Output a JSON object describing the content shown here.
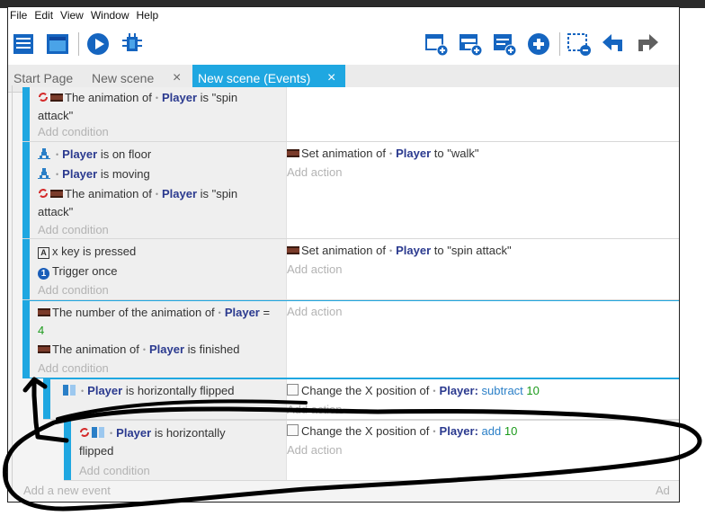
{
  "menu": [
    "File",
    "Edit",
    "View",
    "Window",
    "Help"
  ],
  "toolbar_left_icons": [
    "project-manager-icon",
    "scene-editor-icon",
    "preview-play-icon",
    "debugger-icon"
  ],
  "toolbar_right_icons": [
    "add-event-icon",
    "add-subevent-icon",
    "add-comment-icon",
    "add-more-icon",
    "delete-icon",
    "undo-icon",
    "redo-icon"
  ],
  "tabs": [
    {
      "label": "Start Page",
      "active": false
    },
    {
      "label": "New scene",
      "active": false
    },
    {
      "label": "New scene (Events)",
      "active": true
    }
  ],
  "tab_close_glyph": "×",
  "common": {
    "add_condition": "Add condition",
    "add_action": "Add action",
    "add_new_event": "Add a new event",
    "add_new_event_right": "Ad"
  },
  "events": {
    "e1": {
      "cond1": {
        "pre": "The animation of",
        "obj": "Player",
        "post": "is \"spin attack\""
      }
    },
    "e2": {
      "cond1": {
        "obj": "Player",
        "post": "is on floor"
      },
      "cond2": {
        "obj": "Player",
        "post": "is moving"
      },
      "cond3": {
        "pre": "The animation of",
        "obj": "Player",
        "post": "is \"spin attack\""
      },
      "act1": {
        "pre": "Set animation of",
        "obj": "Player",
        "post": "to \"walk\""
      }
    },
    "e3": {
      "cond1": {
        "key": "x",
        "text": "x key is pressed",
        "glyph": "A"
      },
      "cond2": {
        "text": "Trigger once",
        "glyph": "1"
      },
      "act1": {
        "pre": "Set animation of",
        "obj": "Player",
        "post": "to \"spin attack\""
      }
    },
    "e4": {
      "cond1": {
        "pre": "The number of the animation of",
        "obj": "Player",
        "op": "=",
        "val": "4"
      },
      "cond2": {
        "pre": "The animation of",
        "obj": "Player",
        "post": "is finished"
      }
    },
    "e5": {
      "cond1": {
        "obj": "Player",
        "post": "is horizontally flipped"
      },
      "act1": {
        "pre": "Change the X position of",
        "obj": "Player:",
        "op": "subtract",
        "val": "10"
      }
    },
    "e6": {
      "cond1": {
        "obj": "Player",
        "post": "is horizontally flipped"
      },
      "act1": {
        "pre": "Change the X position of",
        "obj": "Player:",
        "op": "add",
        "val": "10"
      }
    }
  },
  "colors": {
    "accent": "#1fa7e1",
    "object_name": "#2b3a8f",
    "number": "#1b9a1b",
    "operator": "#2a7fc7",
    "placeholder": "#b3b3b3",
    "annotation_ink": "#000000"
  }
}
